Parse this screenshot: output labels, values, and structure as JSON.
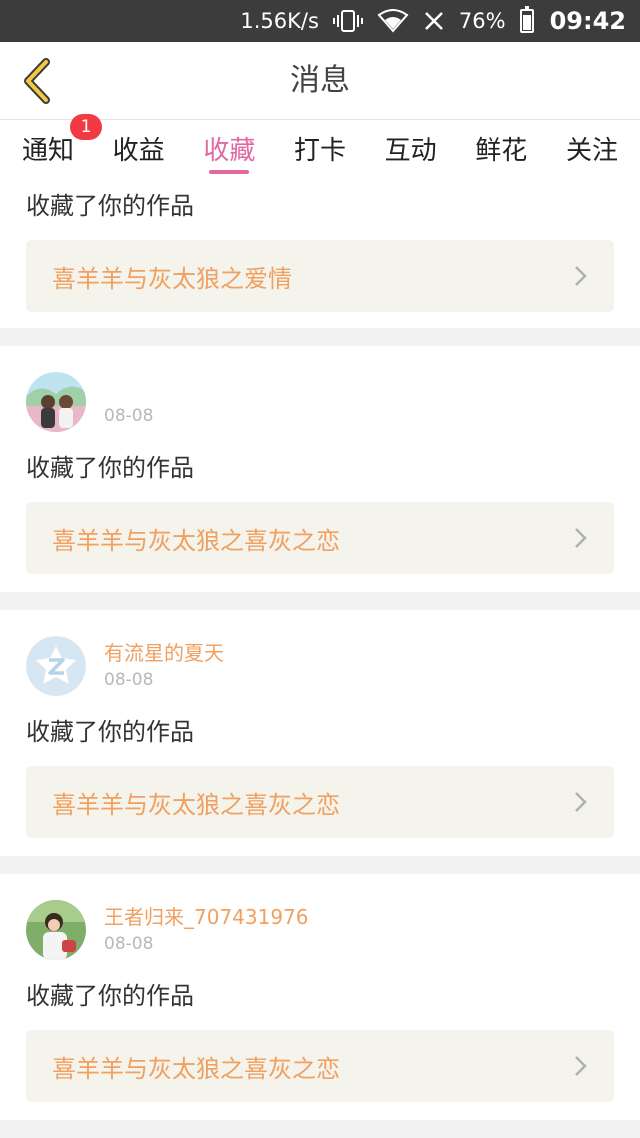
{
  "status_bar": {
    "net_speed": "1.56K/s",
    "battery": "76%",
    "battery_level": 0.76,
    "time": "09:42"
  },
  "header": {
    "title": "消息",
    "back_icon": "chevron-left-icon"
  },
  "tabs": [
    {
      "label": "通知",
      "badge": "1"
    },
    {
      "label": "收益"
    },
    {
      "label": "收藏",
      "active": true
    },
    {
      "label": "打卡"
    },
    {
      "label": "互动"
    },
    {
      "label": "鲜花"
    },
    {
      "label": "关注"
    }
  ],
  "colors": {
    "accent": "#e06aa0",
    "name": "#f0a060",
    "badge": "#f23a45"
  },
  "feed": [
    {
      "action": "收藏了你的作品",
      "work_title": "喜羊羊与灰太狼之爱情"
    },
    {
      "user_name": "",
      "date": "08-08",
      "action": "收藏了你的作品",
      "work_title": "喜羊羊与灰太狼之喜灰之恋",
      "avatar_icon": "photo-avatar"
    },
    {
      "user_name": "有流星的夏天",
      "date": "08-08",
      "action": "收藏了你的作品",
      "work_title": "喜羊羊与灰太狼之喜灰之恋",
      "avatar_icon": "default-avatar-icon"
    },
    {
      "user_name": "王者归来_707431976",
      "date": "08-08",
      "action": "收藏了你的作品",
      "work_title": "喜羊羊与灰太狼之喜灰之恋",
      "avatar_icon": "photo-avatar"
    }
  ]
}
